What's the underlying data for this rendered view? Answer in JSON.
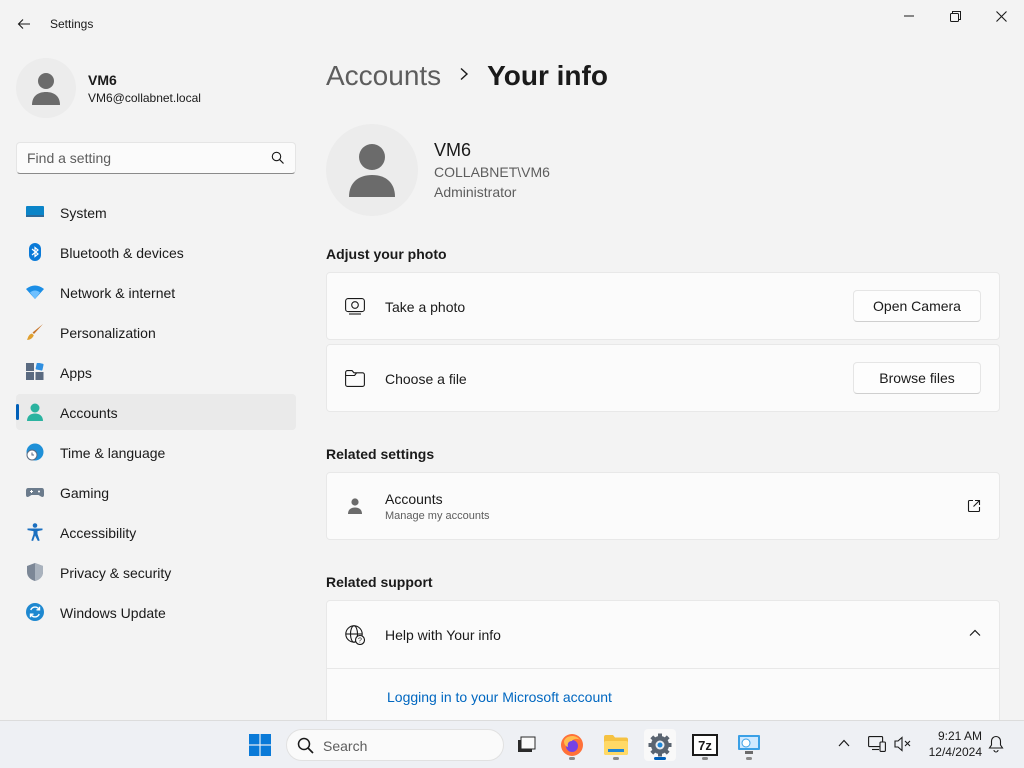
{
  "window": {
    "title": "Settings",
    "controls": [
      "minimize",
      "restore",
      "close"
    ]
  },
  "profile": {
    "name": "VM6",
    "email": "VM6@collabnet.local"
  },
  "search": {
    "placeholder": "Find a setting"
  },
  "sidebar": {
    "items": [
      {
        "label": "System",
        "icon": "system-icon"
      },
      {
        "label": "Bluetooth & devices",
        "icon": "bluetooth-icon"
      },
      {
        "label": "Network & internet",
        "icon": "wifi-icon"
      },
      {
        "label": "Personalization",
        "icon": "paintbrush-icon"
      },
      {
        "label": "Apps",
        "icon": "apps-icon"
      },
      {
        "label": "Accounts",
        "icon": "account-icon",
        "active": true
      },
      {
        "label": "Time & language",
        "icon": "globe-clock-icon"
      },
      {
        "label": "Gaming",
        "icon": "gamepad-icon"
      },
      {
        "label": "Accessibility",
        "icon": "accessibility-icon"
      },
      {
        "label": "Privacy & security",
        "icon": "shield-icon"
      },
      {
        "label": "Windows Update",
        "icon": "update-icon"
      }
    ]
  },
  "breadcrumb": {
    "parent": "Accounts",
    "separator": "›",
    "current": "Your info"
  },
  "user": {
    "name": "VM6",
    "domain": "COLLABNET\\VM6",
    "role": "Administrator"
  },
  "adjust_photo": {
    "title": "Adjust your photo",
    "take_photo": {
      "label": "Take a photo",
      "button": "Open Camera"
    },
    "choose_file": {
      "label": "Choose a file",
      "button": "Browse files"
    }
  },
  "related_settings": {
    "title": "Related settings",
    "accounts": {
      "label": "Accounts",
      "sublabel": "Manage my accounts"
    }
  },
  "related_support": {
    "title": "Related support",
    "help": {
      "label": "Help with Your info",
      "link": "Logging in to your Microsoft account"
    }
  },
  "taskbar": {
    "search_label": "Search",
    "apps": [
      "start-icon",
      "task-view-icon",
      "firefox-icon",
      "file-explorer-icon",
      "settings-icon",
      "7zip-icon",
      "remote-desktop-icon"
    ],
    "time": "9:21 AM",
    "date": "12/4/2024"
  },
  "colors": {
    "accent": "#005fb8",
    "link": "#0067c0",
    "background": "#f3f3f3",
    "card": "#fbfbfb"
  }
}
